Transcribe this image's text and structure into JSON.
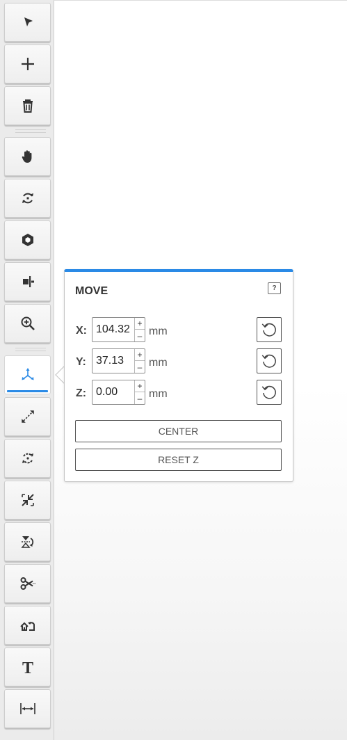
{
  "toolbar": {
    "tools": [
      {
        "name": "select",
        "icon": "select-cursor-icon"
      },
      {
        "name": "add",
        "icon": "plus-icon"
      },
      {
        "name": "delete",
        "icon": "trash-icon"
      },
      {
        "name": "pan",
        "icon": "hand-icon"
      },
      {
        "name": "rotate-view",
        "icon": "rotate-view-icon"
      },
      {
        "name": "view-cube",
        "icon": "cube-icon"
      },
      {
        "name": "section",
        "icon": "section-plane-icon"
      },
      {
        "name": "zoom",
        "icon": "zoom-in-icon"
      },
      {
        "name": "move",
        "icon": "move-axes-icon",
        "active": true
      },
      {
        "name": "scale",
        "icon": "scale-icon"
      },
      {
        "name": "rotate",
        "icon": "rotate-object-icon"
      },
      {
        "name": "shrink",
        "icon": "shrink-arrows-icon"
      },
      {
        "name": "mirror",
        "icon": "mirror-icon"
      },
      {
        "name": "cut",
        "icon": "scissors-icon"
      },
      {
        "name": "place-on-face",
        "icon": "place-face-icon"
      },
      {
        "name": "text",
        "icon": "text-icon"
      },
      {
        "name": "measure",
        "icon": "measure-icon"
      }
    ],
    "accent_color": "#2a8ae6"
  },
  "move_panel": {
    "title": "MOVE",
    "help_label": "?",
    "fields": [
      {
        "label": "X:",
        "value": "104.32",
        "unit": "mm"
      },
      {
        "label": "Y:",
        "value": "37.13",
        "unit": "mm"
      },
      {
        "label": "Z:",
        "value": "0.00",
        "unit": "mm"
      }
    ],
    "spinner_up": "+",
    "spinner_down": "–",
    "center_label": "CENTER",
    "reset_z_label": "RESET Z"
  }
}
